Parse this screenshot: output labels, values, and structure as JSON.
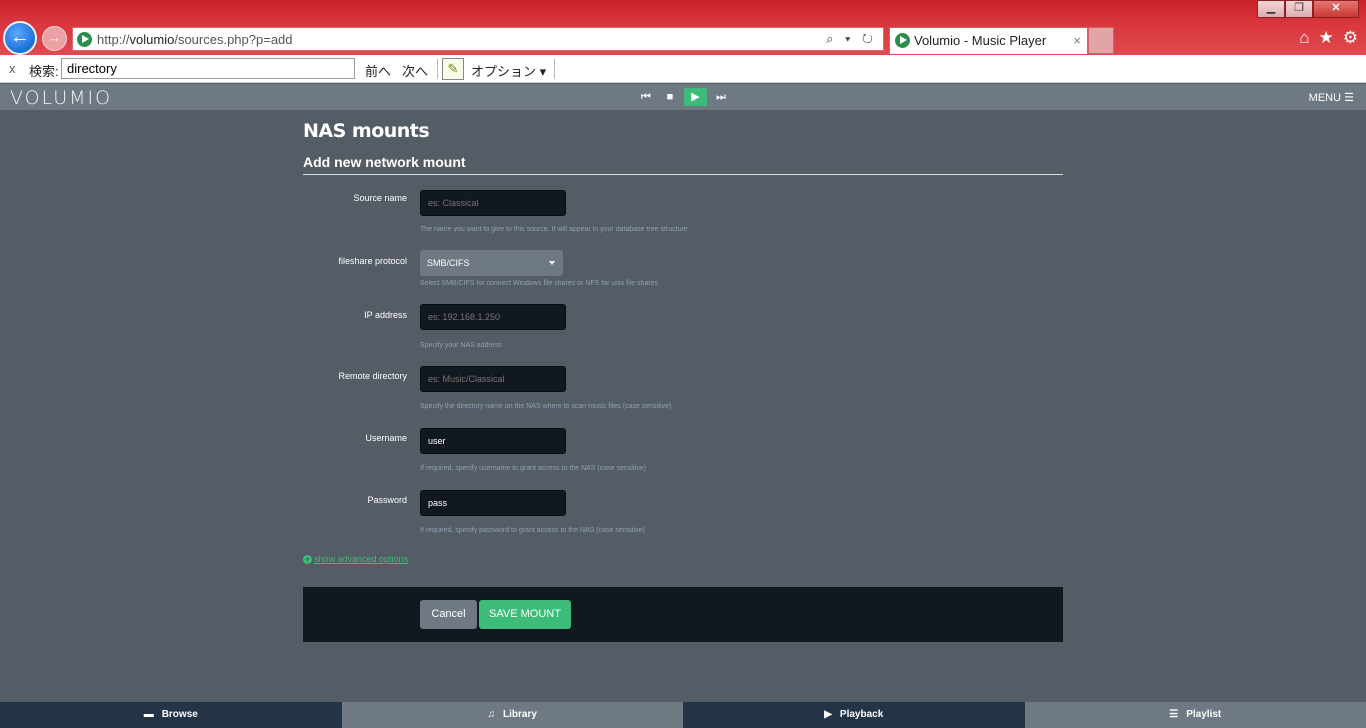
{
  "browser": {
    "url_prefix": "http://",
    "url_host": "volumio",
    "url_path": "/sources.php?p=add",
    "address_tools": "⌕ ▾ ↻",
    "tab_title": "Volumio - Music Player",
    "tab_close": "×",
    "window_buttons": {
      "minimize": "▁",
      "restore": "❐",
      "close": "✕"
    }
  },
  "findbar": {
    "close": "x",
    "label": "検索:",
    "value": "directory",
    "prev": "前へ",
    "next": "次へ",
    "options": "オプション ▾"
  },
  "app": {
    "logo": "VOLUMIO",
    "menu_label": "MENU"
  },
  "page": {
    "title": "NAS mounts",
    "subtitle": "Add new network mount"
  },
  "form": {
    "source_name": {
      "label": "Source name",
      "placeholder": "es: Classical",
      "help": "The name you want to give to this source. It will appear in your database tree structure"
    },
    "protocol": {
      "label": "fileshare protocol",
      "value": "SMB/CIFS",
      "help": "Select SMB/CIFS for connect Windows file shares or NFS for unix file shares"
    },
    "ip_address": {
      "label": "IP address",
      "placeholder": "es: 192.168.1.250",
      "help": "Specify your NAS address"
    },
    "remote_directory": {
      "label": "Remote directory",
      "placeholder": "es: Music/Classical",
      "help": "Specify the directory name on the NAS where to scan music files (case sensitive)"
    },
    "username": {
      "label": "Username",
      "value": "user",
      "help": "If required, specify username to grant access to the NAS (case sensitive)"
    },
    "password": {
      "label": "Password",
      "value": "pass",
      "help": "If required, specify password to grant access to the NAS (case sensitive)"
    },
    "advanced_link": "show advanced options",
    "cancel_label": "Cancel",
    "save_label": "SAVE MOUNT"
  },
  "bottom_nav": {
    "browse": "Browse",
    "library": "Library",
    "playback": "Playback",
    "playlist": "Playlist"
  },
  "colors": {
    "accent_green": "#3dbb78",
    "page_bg": "#545c66",
    "bar_gray": "#6f7983",
    "input_bg": "#121820",
    "nav_dark": "#243446"
  }
}
